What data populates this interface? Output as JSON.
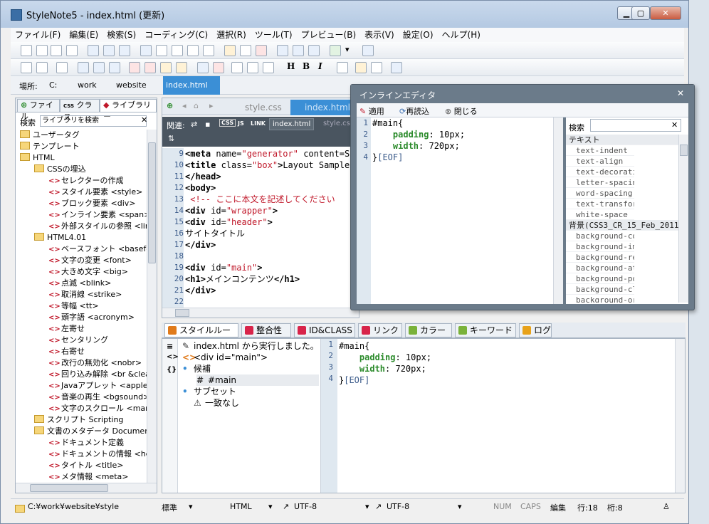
{
  "window": {
    "title": "StyleNote5 - index.html (更新)"
  },
  "menu": [
    "ファイル(F)",
    "編集(E)",
    "検索(S)",
    "コーディング(C)",
    "選択(R)",
    "ツール(T)",
    "プレビュー(B)",
    "表示(V)",
    "設定(O)",
    "ヘルプ(H)"
  ],
  "toolbar2_letters": [
    "H",
    "B",
    "I"
  ],
  "location": {
    "label": "場所:",
    "crumbs": [
      "C:",
      "work",
      "website",
      "index.html"
    ]
  },
  "left_tabs": [
    "ファイル",
    "クラス",
    "ライブラリー"
  ],
  "left_css_tag": "CSS",
  "library": {
    "search_label": "検索",
    "search_placeholder": "ライブラリを検索",
    "clear": "✕",
    "items": [
      {
        "type": "folder",
        "depth": 0,
        "label": "ユーザータグ"
      },
      {
        "type": "folder",
        "depth": 0,
        "label": "テンプレート"
      },
      {
        "type": "folder",
        "depth": 0,
        "label": "HTML"
      },
      {
        "type": "folder",
        "depth": 1,
        "label": "CSSの埋込"
      },
      {
        "type": "tag",
        "depth": 2,
        "label": "セレクターの作成"
      },
      {
        "type": "tag",
        "depth": 2,
        "label": "スタイル要素 <style>"
      },
      {
        "type": "tag",
        "depth": 2,
        "label": "ブロック要素 <div>"
      },
      {
        "type": "tag",
        "depth": 2,
        "label": "インライン要素 <span>"
      },
      {
        "type": "tag",
        "depth": 2,
        "label": "外部スタイルの参照 <link"
      },
      {
        "type": "folder",
        "depth": 1,
        "label": "HTML4.01"
      },
      {
        "type": "tag",
        "depth": 2,
        "label": "ベースフォント <basefont"
      },
      {
        "type": "tag",
        "depth": 2,
        "label": "文字の変更 <font>"
      },
      {
        "type": "tag",
        "depth": 2,
        "label": "大きめ文字 <big>"
      },
      {
        "type": "tag",
        "depth": 2,
        "label": "点滅 <blink>"
      },
      {
        "type": "tag",
        "depth": 2,
        "label": "取消線 <strike>"
      },
      {
        "type": "tag",
        "depth": 2,
        "label": "等幅 <tt>"
      },
      {
        "type": "tag",
        "depth": 2,
        "label": "頭字語 <acronym>"
      },
      {
        "type": "tag",
        "depth": 2,
        "label": "左寄せ"
      },
      {
        "type": "tag",
        "depth": 2,
        "label": "センタリング"
      },
      {
        "type": "tag",
        "depth": 2,
        "label": "右寄せ"
      },
      {
        "type": "tag",
        "depth": 2,
        "label": "改行の無効化 <nobr>"
      },
      {
        "type": "tag",
        "depth": 2,
        "label": "回り込み解除 <br &clea"
      },
      {
        "type": "tag",
        "depth": 2,
        "label": "Javaアプレット <applet>"
      },
      {
        "type": "tag",
        "depth": 2,
        "label": "音楽の再生 <bgsound>"
      },
      {
        "type": "tag",
        "depth": 2,
        "label": "文字のスクロール <marqu"
      },
      {
        "type": "folder",
        "depth": 1,
        "label": "スクリプト Scripting"
      },
      {
        "type": "folder",
        "depth": 1,
        "label": "文書のメタデータ Document"
      },
      {
        "type": "tag",
        "depth": 2,
        "label": "ドキュメント定義"
      },
      {
        "type": "tag",
        "depth": 2,
        "label": "ドキュメントの情報 <head"
      },
      {
        "type": "tag",
        "depth": 2,
        "label": "タイトル <title>"
      },
      {
        "type": "tag",
        "depth": 2,
        "label": "メタ情報 <meta>"
      }
    ]
  },
  "editor": {
    "tabs": [
      "style.css",
      "index.html"
    ],
    "related_label": "関連:",
    "related_items": [
      "CSS",
      "JS",
      "LINK",
      "index.html",
      "style.css"
    ],
    "line_numbers": [
      "9",
      "10",
      "11",
      "12",
      "13",
      "14",
      "15",
      "16",
      "17",
      "18",
      "19",
      "20",
      "21",
      "22"
    ],
    "lines": [
      "<meta name=\"generator\" content=\"S",
      "<title class=\"box\">Layout Sample</",
      "</head>",
      "<body>",
      " <!-- ここに本文を記述してください",
      "<div id=\"wrapper\">",
      "<div id=\"header\">",
      "サイトタイトル",
      "</div>",
      "",
      "<div id=\"main\">",
      "<h1>メインコンテンツ</h1>",
      "</div>",
      ""
    ]
  },
  "bottom_tabs": [
    {
      "label": "スタイルルーペ",
      "color": "#e07a1a"
    },
    {
      "label": "整合性",
      "color": "#d8244a"
    },
    {
      "label": "ID&CLASS",
      "color": "#d8244a"
    },
    {
      "label": "リンク",
      "color": "#d8244a"
    },
    {
      "label": "カラー",
      "color": "#7ab23a"
    },
    {
      "label": "キーワード",
      "color": "#7ab23a"
    },
    {
      "label": "ログ",
      "color": "#e8a21a"
    }
  ],
  "style_loupe": {
    "items": [
      {
        "icon": "pencil-icon",
        "text": "index.html から実行しました。"
      },
      {
        "icon": "tag-icon",
        "text": "<div id=\"main\">"
      },
      {
        "icon": "bullet",
        "text": "候補"
      },
      {
        "icon": "hash-icon",
        "text": "#main"
      },
      {
        "icon": "bullet",
        "text": "サブセット"
      },
      {
        "icon": "warning-icon",
        "text": "一致なし"
      }
    ],
    "line_numbers": [
      "1",
      "2",
      "3",
      "4"
    ],
    "code": [
      "#main{",
      "    padding: 10px;",
      "    width: 720px;",
      "}[EOF]"
    ]
  },
  "inline_editor": {
    "title": "インラインエディタ",
    "close": "✕",
    "buttons": [
      "適用",
      "再読込",
      "閉じる"
    ],
    "line_numbers": [
      "1",
      "2",
      "3",
      "4"
    ],
    "code": [
      "#main{",
      "    padding: 10px;",
      "    width: 720px;",
      "}[EOF]"
    ],
    "prop_search_label": "検索",
    "prop_groups": [
      {
        "name": "テキスト",
        "items": [
          "text-indent",
          "text-align",
          "text-decoration",
          "letter-spacing",
          "word-spacing",
          "text-transform",
          "white-space"
        ]
      },
      {
        "name": "背景(CSS3_CR_15_Feb_2011)",
        "items": [
          "background-color",
          "background-image",
          "background-repeat",
          "background-attachment",
          "background-position",
          "background-clip",
          "background-origin"
        ]
      }
    ]
  },
  "status": {
    "path": "C:¥work¥website¥style",
    "mode": "標準",
    "type": "HTML",
    "enc1": "UTF-8",
    "enc2": "UTF-8",
    "num": "NUM",
    "caps": "CAPS",
    "edit": "編集",
    "line": "行:18",
    "col": "桁:8"
  }
}
